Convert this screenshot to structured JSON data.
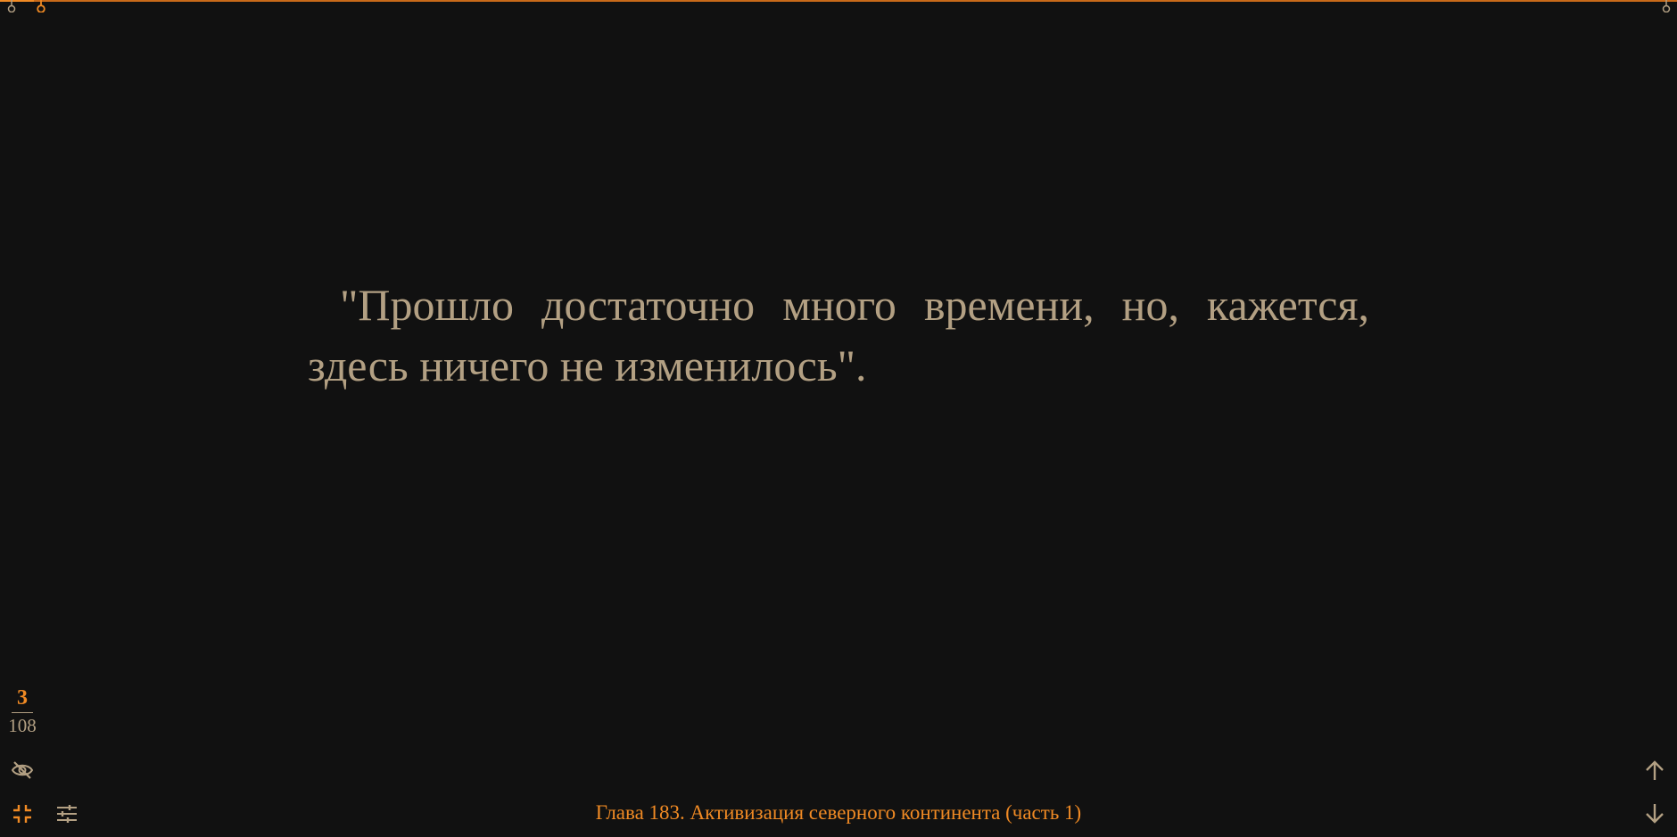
{
  "reader": {
    "text": "\"Прошло достаточно много времени, но, кажется, здесь ничего не изменилось\".",
    "chapter_title": "Глава 183. Активизация северного континента (часть 1)",
    "page": {
      "current": "3",
      "total": "108"
    },
    "progress_fraction": 0.02
  },
  "icons": {
    "hide": "eye-off-icon",
    "exit_fullscreen": "exit-fullscreen-icon",
    "settings": "sliders-icon",
    "scroll_up": "arrow-up-icon",
    "scroll_down": "arrow-down-icon"
  },
  "colors": {
    "background": "#111111",
    "text": "#b3a083",
    "accent": "#f08a24"
  }
}
